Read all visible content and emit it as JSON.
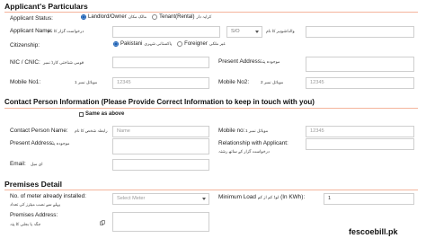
{
  "applicant": {
    "section_title": "Applicant's Particulars",
    "status": {
      "label": "Applicant Status:",
      "urdu": "کرایہ دار",
      "options": [
        {
          "label": "Landlord/Owner",
          "urdu": "مالک مکان",
          "selected": true
        },
        {
          "label": "Tenant(Rental)",
          "urdu": "کرایہ دار",
          "selected": false
        }
      ]
    },
    "name": {
      "label": "Applicant Name:",
      "urdu": "درخواست گزار کا نام",
      "value": ""
    },
    "relation": {
      "value": "S/O"
    },
    "father_name": {
      "urdu": "والد/شوہر کا نام",
      "value": ""
    },
    "citizenship": {
      "label": "Citizenship:",
      "options": [
        {
          "label": "Pakistani",
          "urdu": "پاکستانی شہری",
          "selected": true
        },
        {
          "label": "Foreigner",
          "urdu": "غیر ملکی",
          "selected": false
        }
      ]
    },
    "cnic": {
      "label": "NIC / CNIC:",
      "urdu": "قومی شناختی کارڈ نمبر",
      "value": ""
    },
    "present_address": {
      "label": "Present Address:",
      "urdu": "موجودہ پتہ",
      "value": ""
    },
    "mobile1": {
      "label": "Mobile No1:",
      "urdu": "موبائل نمبر 1",
      "placeholder": "12345"
    },
    "mobile2": {
      "label": "Mobile No2:",
      "urdu": "موبائل نمبر 2",
      "placeholder": "12345"
    }
  },
  "contact": {
    "section_title": "Contact Person Information (Please Provide Correct Information to keep in touch with you)",
    "same_as_above": "Same as above",
    "name": {
      "label": "Contact Person Name:",
      "urdu": "رابطہ شخص کا نام",
      "placeholder": "Name"
    },
    "mobile": {
      "label": "Mobile no:",
      "urdu": "موبائل نمبر 1",
      "placeholder": "12345"
    },
    "present_address": {
      "label": "Present Address:",
      "urdu": "موجودہ پتہ",
      "value": ""
    },
    "relationship": {
      "label": "Relationship with Applicant:",
      "urdu": "درخواست گزار کے ساتھ رشتہ",
      "value": ""
    },
    "email": {
      "label": "Email:",
      "urdu": "ای میل",
      "value": ""
    }
  },
  "premises": {
    "section_title": "Premises Detail",
    "meters": {
      "label": "No. of meter already installed:",
      "urdu": "پہلے سے نصب میٹرز کی تعداد",
      "placeholder": "Select Meter"
    },
    "min_load": {
      "label": "Minimum Load",
      "urdu": "لوڈ کم از کم",
      "unit": "(In KWh):",
      "value": "1"
    },
    "premises_address": {
      "label": "Premises Address:",
      "urdu": "جگہ یا بجلی کا پتہ",
      "value": ""
    }
  },
  "watermark": "fescoebill.pk",
  "colors": {
    "divider": "#f4b49c",
    "radio_selected": "#1a5fb4",
    "field_border": "#cfcfcf"
  }
}
